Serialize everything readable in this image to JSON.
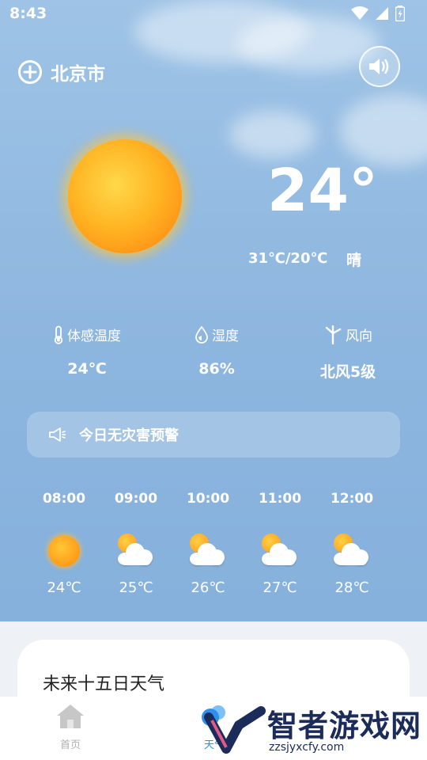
{
  "status_bar": {
    "time": "8:43"
  },
  "header": {
    "city": "北京市"
  },
  "current": {
    "temperature": "24°",
    "range": "31℃/20℃",
    "condition": "晴"
  },
  "metrics": [
    {
      "label": "体感温度",
      "value": "24℃",
      "icon": "thermometer-icon"
    },
    {
      "label": "湿度",
      "value": "86%",
      "icon": "droplet-icon"
    },
    {
      "label": "风向",
      "value": "北风5级",
      "icon": "wind-turbine-icon"
    }
  ],
  "alert": {
    "text": "今日无灾害预警",
    "icon": "megaphone-icon"
  },
  "hourly": [
    {
      "time": "08:00",
      "temp": "24℃",
      "icon": "sun-icon"
    },
    {
      "time": "09:00",
      "temp": "25℃",
      "icon": "partly-cloudy-icon"
    },
    {
      "time": "10:00",
      "temp": "26℃",
      "icon": "partly-cloudy-icon"
    },
    {
      "time": "11:00",
      "temp": "27℃",
      "icon": "partly-cloudy-icon"
    },
    {
      "time": "12:00",
      "temp": "28℃",
      "icon": "partly-cloudy-icon"
    }
  ],
  "forecast": {
    "title": "未来十五日天气"
  },
  "tabs": [
    {
      "label": "首页",
      "icon": "home-icon",
      "active": false
    },
    {
      "label": "天气",
      "icon": "weather-icon",
      "active": true
    }
  ],
  "watermark": {
    "brand": "智者游戏网",
    "url": "zzsjyxcfy.com"
  },
  "colors": {
    "sky": "#8db6df",
    "sun": "#ffa21c",
    "text_on_sky": "#ffffff",
    "active_tab": "#2f8ff0",
    "inactive_tab": "#b0b0b0"
  }
}
